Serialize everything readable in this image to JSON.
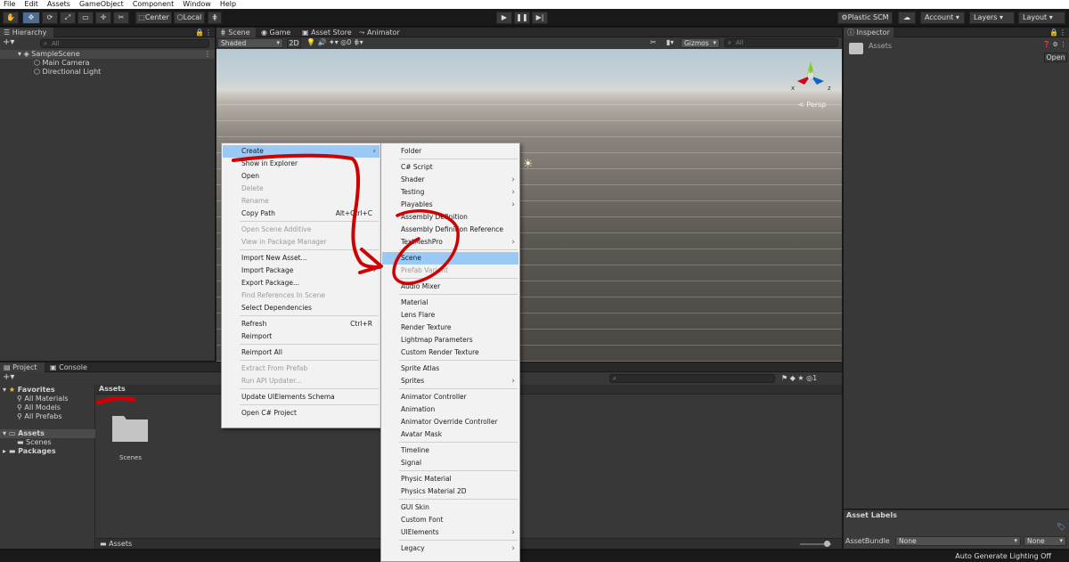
{
  "menubar": [
    "File",
    "Edit",
    "Assets",
    "GameObject",
    "Component",
    "Window",
    "Help"
  ],
  "toolbar": {
    "pivot": "Center",
    "space": "Local",
    "plastic": "Plastic SCM",
    "account": "Account",
    "layers": "Layers",
    "layout": "Layout"
  },
  "hierarchy": {
    "tab": "Hierarchy",
    "search_placeholder": "All",
    "scene": "SampleScene",
    "items": [
      "Main Camera",
      "Directional Light"
    ]
  },
  "scene_view": {
    "tabs": [
      "Scene",
      "Game",
      "Asset Store",
      "Animator"
    ],
    "shading": "Shaded",
    "mode_2d": "2D",
    "hidden_count": "0",
    "gizmos": "Gizmos",
    "search_placeholder": "All",
    "persp": "< Persp",
    "axis_x": "x",
    "axis_z": "z"
  },
  "inspector": {
    "tab": "Inspector",
    "title": "Assets",
    "open_button": "Open",
    "asset_labels": "Asset Labels",
    "asset_bundle_label": "AssetBundle",
    "asset_bundle_value": "None",
    "asset_variant_value": "None"
  },
  "project": {
    "tabs": [
      "Project",
      "Console"
    ],
    "favorites": "Favorites",
    "favorite_items": [
      "All Materials",
      "All Models",
      "All Prefabs"
    ],
    "assets": "Assets",
    "scenes": "Scenes",
    "packages": "Packages",
    "breadcrumb": "Assets",
    "folder_label": "Scenes",
    "footer_path": "Assets",
    "hidden_count": "1"
  },
  "context_menu": {
    "items": [
      {
        "label": "Create",
        "arrow": true,
        "highlight": true
      },
      {
        "label": "Show in Explorer"
      },
      {
        "label": "Open"
      },
      {
        "label": "Delete",
        "disabled": true
      },
      {
        "label": "Rename",
        "disabled": true
      },
      {
        "label": "Copy Path",
        "shortcut": "Alt+Ctrl+C"
      },
      {
        "label": "Open Scene Additive",
        "disabled": true
      },
      {
        "label": "View in Package Manager",
        "disabled": true
      },
      {
        "label": "Import New Asset..."
      },
      {
        "label": "Import Package",
        "arrow": true
      },
      {
        "label": "Export Package..."
      },
      {
        "label": "Find References In Scene",
        "disabled": true
      },
      {
        "label": "Select Dependencies"
      },
      {
        "label": "Refresh",
        "shortcut": "Ctrl+R"
      },
      {
        "label": "Reimport"
      },
      {
        "label": "Reimport All"
      },
      {
        "label": "Extract From Prefab",
        "disabled": true
      },
      {
        "label": "Run API Updater...",
        "disabled": true
      },
      {
        "label": "Update UIElements Schema"
      },
      {
        "label": "Open C# Project"
      }
    ]
  },
  "create_submenu": {
    "items": [
      {
        "label": "Folder"
      },
      {
        "label": "C# Script"
      },
      {
        "label": "Shader",
        "arrow": true
      },
      {
        "label": "Testing",
        "arrow": true
      },
      {
        "label": "Playables",
        "arrow": true
      },
      {
        "label": "Assembly Definition"
      },
      {
        "label": "Assembly Definition Reference"
      },
      {
        "label": "TextMeshPro",
        "arrow": true
      },
      {
        "label": "Scene",
        "highlight": true
      },
      {
        "label": "Prefab Variant",
        "disabled": true
      },
      {
        "label": "Audio Mixer"
      },
      {
        "label": "Material"
      },
      {
        "label": "Lens Flare"
      },
      {
        "label": "Render Texture"
      },
      {
        "label": "Lightmap Parameters"
      },
      {
        "label": "Custom Render Texture"
      },
      {
        "label": "Sprite Atlas"
      },
      {
        "label": "Sprites",
        "arrow": true
      },
      {
        "label": "Animator Controller"
      },
      {
        "label": "Animation"
      },
      {
        "label": "Animator Override Controller"
      },
      {
        "label": "Avatar Mask"
      },
      {
        "label": "Timeline"
      },
      {
        "label": "Signal"
      },
      {
        "label": "Physic Material"
      },
      {
        "label": "Physics Material 2D"
      },
      {
        "label": "GUI Skin"
      },
      {
        "label": "Custom Font"
      },
      {
        "label": "UIElements",
        "arrow": true
      },
      {
        "label": "Legacy",
        "arrow": true
      }
    ]
  },
  "status": {
    "right": "Auto Generate Lighting Off"
  },
  "colors": {
    "highlight": "#99c9f4",
    "annotation": "#cc0000"
  }
}
